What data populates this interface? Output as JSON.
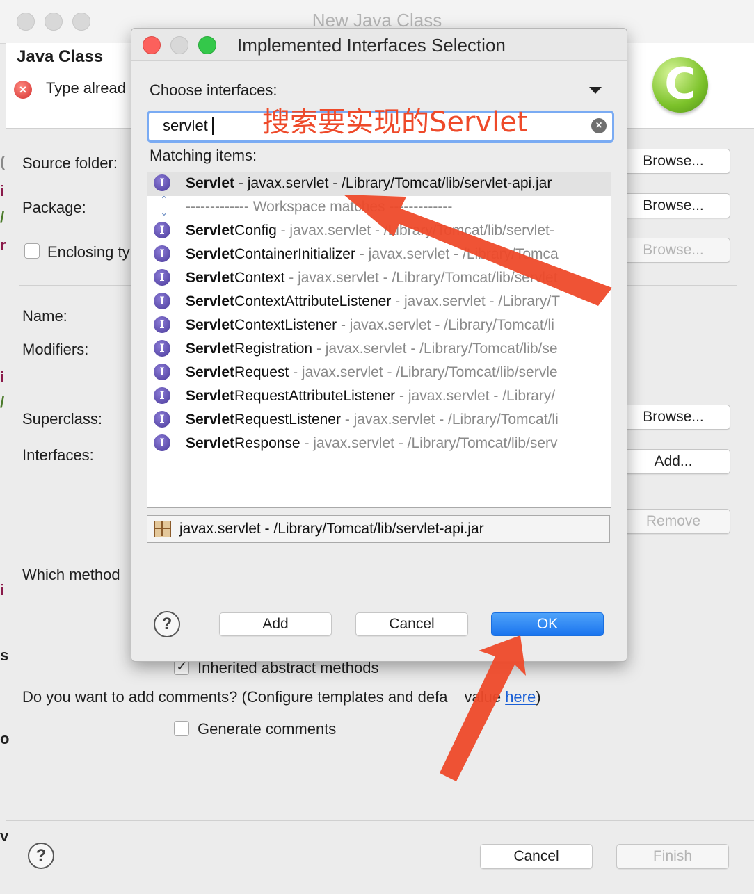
{
  "background_window": {
    "title": "New Java Class",
    "header_title": "Java Class",
    "header_message": "Type alread",
    "labels": {
      "source_folder": "Source folder:",
      "package": "Package:",
      "enclosing": "Enclosing ty",
      "name": "Name:",
      "modifiers": "Modifiers:",
      "superclass": "Superclass:",
      "interfaces": "Interfaces:",
      "which_method": "Which method"
    },
    "buttons": {
      "browse": "Browse...",
      "add": "Add...",
      "remove": "Remove",
      "cancel": "Cancel",
      "finish": "Finish"
    },
    "inherited_methods_label": "Inherited abstract methods",
    "comments_question": "Do you want to add comments? (Configure templates and defa",
    "comments_question_tail": "value",
    "comments_link": "here",
    "comments_close": ")",
    "generate_comments_label": "Generate comments"
  },
  "dialog": {
    "title": "Implemented Interfaces Selection",
    "choose_label": "Choose interfaces:",
    "search_value": "servlet",
    "annotation_search": "搜索要实现的Servlet",
    "matching_label": "Matching items:",
    "separator_text": "------------- Workspace matches -------------",
    "items": [
      {
        "bold": "Servlet",
        "rest": " - javax.servlet - /Library/Tomcat/lib/servlet-api.jar",
        "selected": true
      },
      {
        "bold": "Servlet",
        "plain": "Config",
        "rest": " - javax.servlet - /Library/Tomcat/lib/servlet-"
      },
      {
        "bold": "Servlet",
        "plain": "ContainerInitializer",
        "rest": " - javax.servlet - /Library/Tomca"
      },
      {
        "bold": "Servlet",
        "plain": "Context",
        "rest": " - javax.servlet - /Library/Tomcat/lib/servlet"
      },
      {
        "bold": "Servlet",
        "plain": "ContextAttributeListener",
        "rest": " - javax.servlet - /Library/T"
      },
      {
        "bold": "Servlet",
        "plain": "ContextListener",
        "rest": " - javax.servlet - /Library/Tomcat/li"
      },
      {
        "bold": "Servlet",
        "plain": "Registration",
        "rest": " - javax.servlet - /Library/Tomcat/lib/se"
      },
      {
        "bold": "Servlet",
        "plain": "Request",
        "rest": " - javax.servlet - /Library/Tomcat/lib/servle"
      },
      {
        "bold": "Servlet",
        "plain": "RequestAttributeListener",
        "rest": " - javax.servlet - /Library/"
      },
      {
        "bold": "Servlet",
        "plain": "RequestListener",
        "rest": " - javax.servlet - /Library/Tomcat/li"
      },
      {
        "bold": "Servlet",
        "plain": "Response",
        "rest": " - javax.servlet - /Library/Tomcat/lib/serv"
      }
    ],
    "status_text": "javax.servlet - /Library/Tomcat/lib/servlet-api.jar",
    "buttons": {
      "add": "Add",
      "cancel": "Cancel",
      "ok": "OK"
    }
  },
  "colors": {
    "accent_blue": "#1a74ee",
    "annotation_red": "#ee4a2a",
    "link_blue": "#1a5fd6"
  }
}
